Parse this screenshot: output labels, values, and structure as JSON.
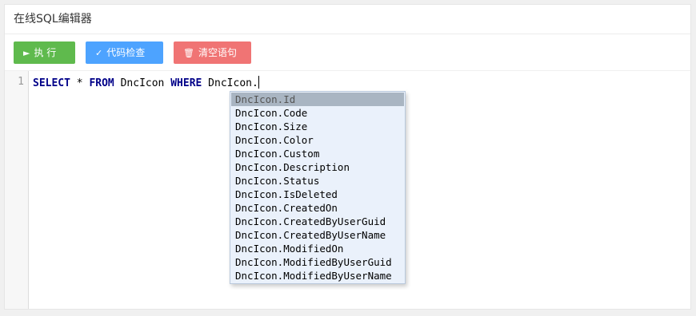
{
  "header": {
    "title": "在线SQL编辑器"
  },
  "toolbar": {
    "run_label": "执 行",
    "check_label": "代码检查",
    "clear_label": "清空语句",
    "run_icon": "play-icon",
    "check_icon": "check-icon",
    "clear_icon": "trash-icon"
  },
  "editor": {
    "line_number": "1",
    "tokens": {
      "select": "SELECT",
      "star": " * ",
      "from": "FROM",
      "table": " DncIcon ",
      "where": "WHERE",
      "typed": " DncIcon."
    }
  },
  "autocomplete": {
    "selected_index": 0,
    "items": [
      "DncIcon.Id",
      "DncIcon.Code",
      "DncIcon.Size",
      "DncIcon.Color",
      "DncIcon.Custom",
      "DncIcon.Description",
      "DncIcon.Status",
      "DncIcon.IsDeleted",
      "DncIcon.CreatedOn",
      "DncIcon.CreatedByUserGuid",
      "DncIcon.CreatedByUserName",
      "DncIcon.ModifiedOn",
      "DncIcon.ModifiedByUserGuid",
      "DncIcon.ModifiedByUserName"
    ]
  },
  "colors": {
    "run": "#5fba4d",
    "check": "#4da3ff",
    "clear": "#f07474",
    "keyword": "#000088"
  }
}
